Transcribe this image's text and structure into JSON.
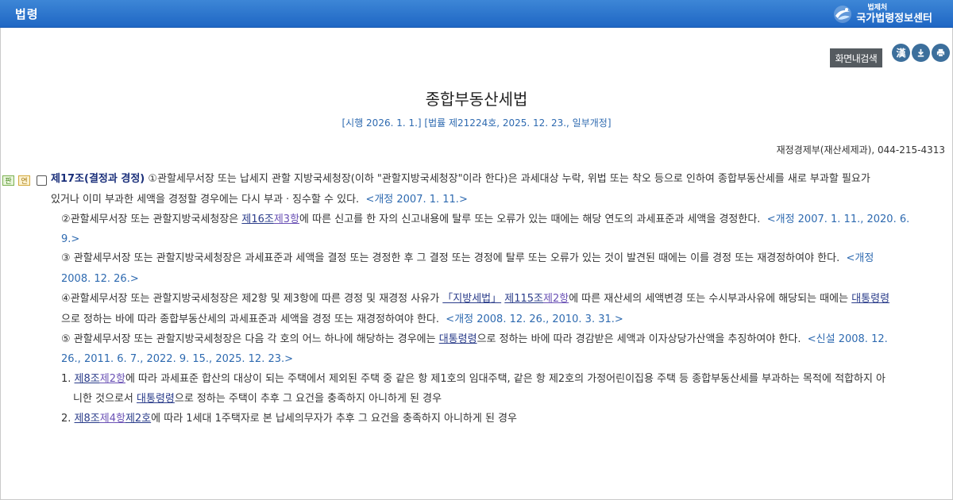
{
  "header": {
    "title": "법령",
    "brand_small": "법제처",
    "brand_big": "국가법령정보센터"
  },
  "toolbar": {
    "search_label": "화면내검색",
    "hanja_label": "漢"
  },
  "law": {
    "title": "종합부동산세법",
    "meta": "[시행 2026. 1. 1.] [법률 제21224호, 2025. 12. 23., 일부개정]",
    "department": "재정경제부(재산세제과), 044-215-4313"
  },
  "article": {
    "badge_pan": "판",
    "badge_yeon": "연",
    "heading": "제17조(결정과 경정)",
    "p1_a": " ①관할세무서장 또는 납세지 관할 지방국세청장(이하 \"관할지방국세청장\"이라 한다)은 과세대상 누락, 위법 또는 착오 등으로 인하여 종합부동산세를 새로 부과할 필요가",
    "p1_b": "있거나 이미 부과한 세액을 경정할 경우에는 다시 부과ㆍ징수할 수 있다.",
    "p1_rev": "<개정 2007. 1. 11.>",
    "p2_a": "②관할세무서장 또는 관할지방국세청장은 ",
    "p2_link1": "제16조",
    "p2_link2": "제3항",
    "p2_b": "에 따른 신고를 한 자의 신고내용에 탈루 또는 오류가 있는 때에는 해당 연도의 과세표준과 세액을 경정한다.",
    "p2_rev_a": "<개정 2007. 1. 11., 2020. 6.",
    "p2_rev_b": "9.>",
    "p3_a": "③ 관할세무서장 또는 관할지방국세청장은 과세표준과 세액을 결정 또는 경정한 후 그 결정 또는 경정에 탈루 또는 오류가 있는 것이 발견된 때에는 이를 경정 또는 재경정하여야 한다.",
    "p3_rev_a": "<개정",
    "p3_rev_b": "2008. 12. 26.>",
    "p4_a": "④관할세무서장 또는 관할지방국세청장은 제2항 및 제3항에 따른 경정 및 재경정 사유가 ",
    "p4_link1": "「지방세법」",
    "p4_link2": "제115조",
    "p4_link3": "제2항",
    "p4_b": "에 따른 재산세의 세액변경 또는 수시부과사유에 해당되는 때에는 ",
    "p4_link4": "대통령령",
    "p4_c": "으로 정하는 바에 따라 종합부동산세의 과세표준과 세액을 경정 또는 재경정하여야 한다.",
    "p4_rev": "<개정 2008. 12. 26., 2010. 3. 31.>",
    "p5_a": "⑤ 관할세무서장 또는 관할지방국세청장은 다음 각 호의 어느 하나에 해당하는 경우에는 ",
    "p5_link": "대통령령",
    "p5_b": "으로 정하는 바에 따라 경감받은 세액과 이자상당가산액을 추징하여야 한다.",
    "p5_rev_a": "<신설 2008. 12.",
    "p5_rev_b": "26., 2011. 6. 7., 2022. 9. 15., 2025. 12. 23.>",
    "i1_num": "1. ",
    "i1_link1": "제8조",
    "i1_link2": "제2항",
    "i1_a": "에 따라 과세표준 합산의 대상이 되는 주택에서 제외된 주택 중 같은 항 제1호의 임대주택, 같은 항 제2호의 가정어린이집용 주택 등 종합부동산세를 부과하는 목적에 적합하지 아",
    "i1_b": "니한 것으로서 ",
    "i1_link3": "대통령령",
    "i1_c": "으로 정하는 주택이 추후 그 요건을 충족하지 아니하게 된 경우",
    "i2_num": "2. ",
    "i2_link1": "제8조",
    "i2_link2": "제4항",
    "i2_link3": "제2호",
    "i2_a": "에 따라 1세대 1주택자로 본 납세의무자가 추후 그 요건을 충족하지 아니하게 된 경우"
  }
}
